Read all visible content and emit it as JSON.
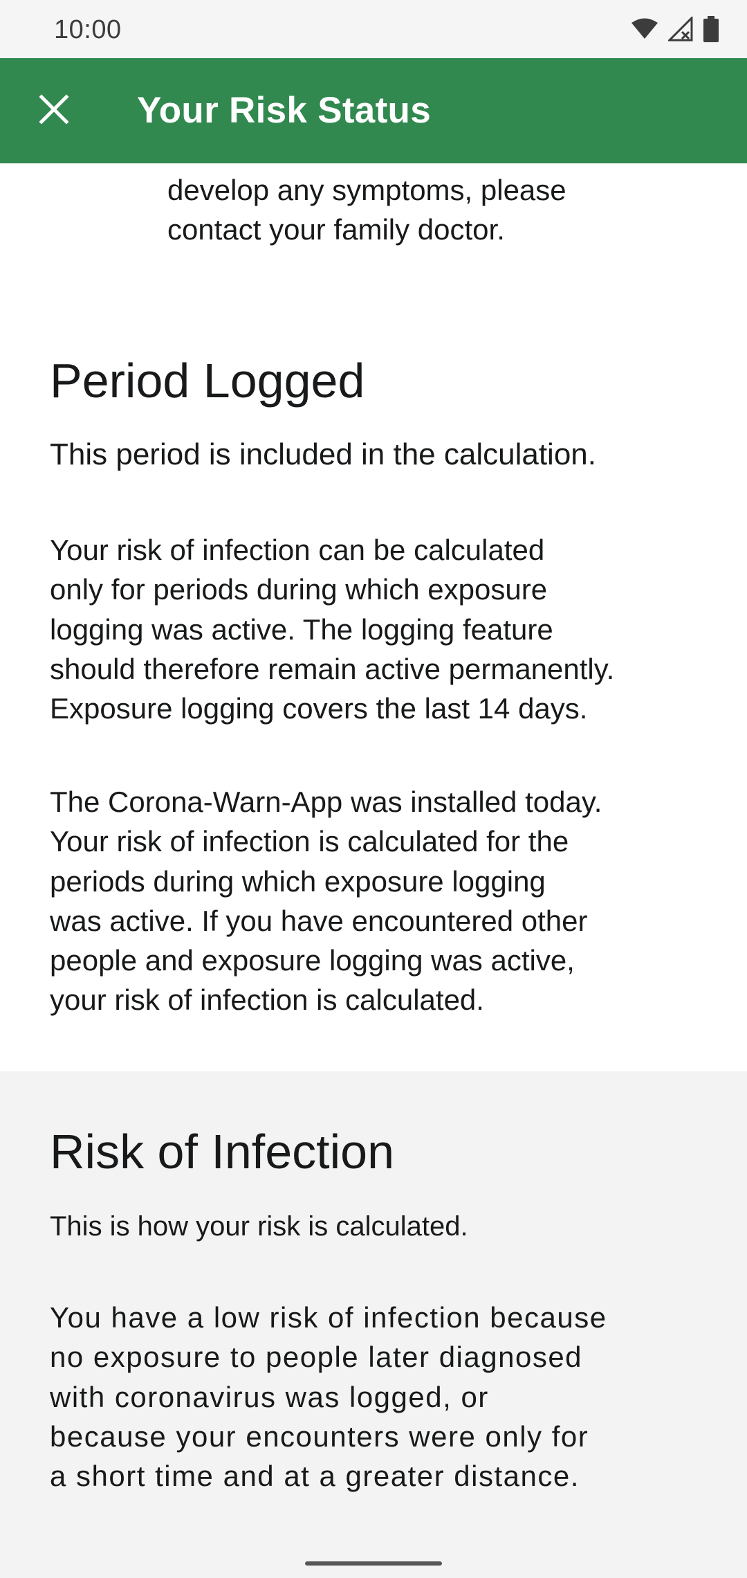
{
  "status_bar": {
    "time": "10:00",
    "icons": [
      "wifi-icon",
      "cellular-no-signal-icon",
      "battery-icon"
    ]
  },
  "app_bar": {
    "title": "Your Risk Status",
    "close_icon": "close-icon",
    "background_color": "#31894f"
  },
  "partial_block": {
    "line1": "develop any symptoms, please",
    "line2": "contact your family doctor."
  },
  "period_logged": {
    "title": "Period Logged",
    "subtitle": "This period is included in the calculation.",
    "paragraph1": [
      "Your risk of infection can be calculated",
      "only for periods during which exposure",
      "logging was active. The logging feature",
      "should therefore remain active permanently.",
      "Exposure logging covers the last 14 days."
    ],
    "paragraph2": [
      "The Corona-Warn-App was installed today.",
      "Your risk of infection is calculated for the",
      "periods during which exposure logging",
      "was active. If you have encountered other",
      "people and exposure logging was active,",
      "your risk of infection is calculated."
    ]
  },
  "risk_of_infection": {
    "title": "Risk of Infection",
    "subtitle": "This is how your risk is calculated.",
    "paragraph": [
      "You have a low risk of infection because",
      "no exposure to people later diagnosed",
      "with coronavirus was logged, or",
      "because your encounters were only for",
      "a short time and at a greater distance."
    ]
  }
}
